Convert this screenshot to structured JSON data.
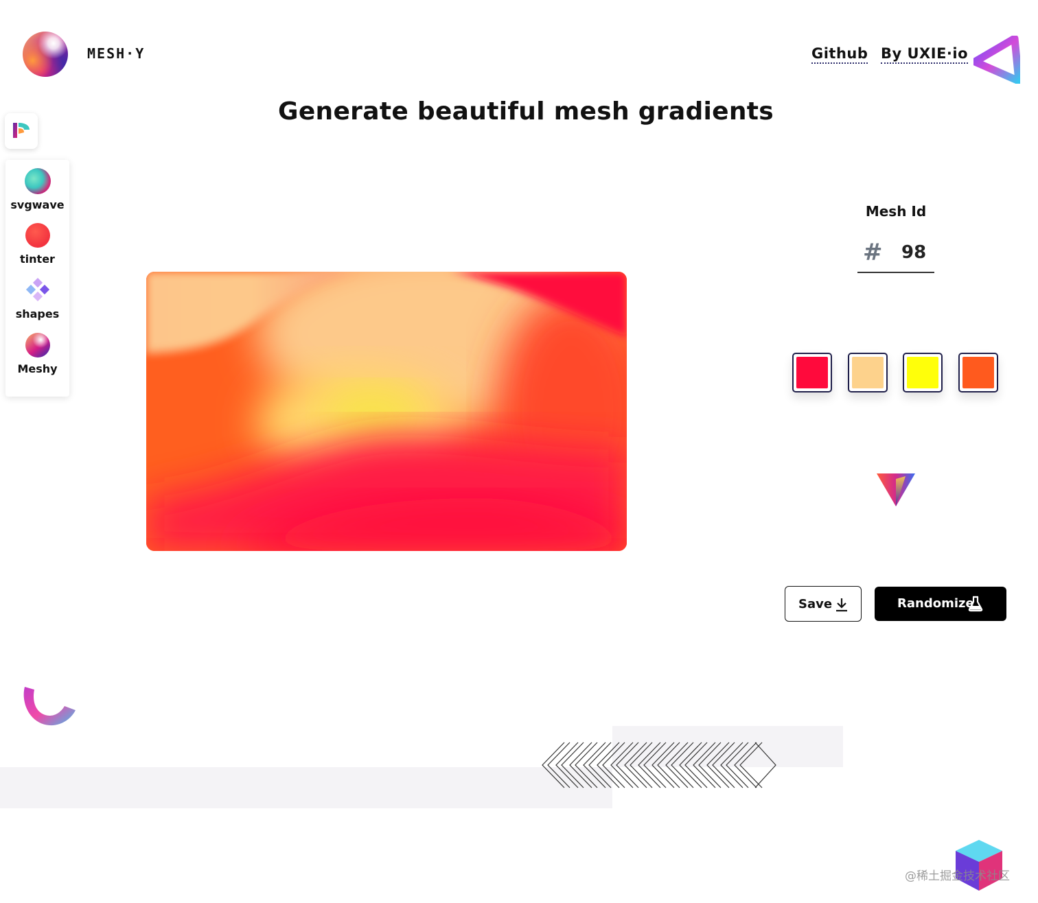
{
  "header": {
    "brand": "MESH·Y",
    "links": [
      "Github",
      "By UXIE·io"
    ]
  },
  "headline": "Generate beautiful mesh gradients",
  "sidebar": {
    "items": [
      {
        "label": "svgwave",
        "icon": "svgwave-icon"
      },
      {
        "label": "tinter",
        "icon": "tinter-icon"
      },
      {
        "label": "shapes",
        "icon": "shapes-icon"
      },
      {
        "label": "Meshy",
        "icon": "meshy-icon"
      }
    ]
  },
  "mesh_id": {
    "label": "Mesh Id",
    "hash": "#",
    "value": "98"
  },
  "palette": [
    "#ff0a3c",
    "#fdd28c",
    "#ffff0a",
    "#ff5a1e"
  ],
  "buttons": {
    "save": "Save",
    "randomize": "Randomize"
  },
  "watermark": "@稀土掘金技术社区"
}
